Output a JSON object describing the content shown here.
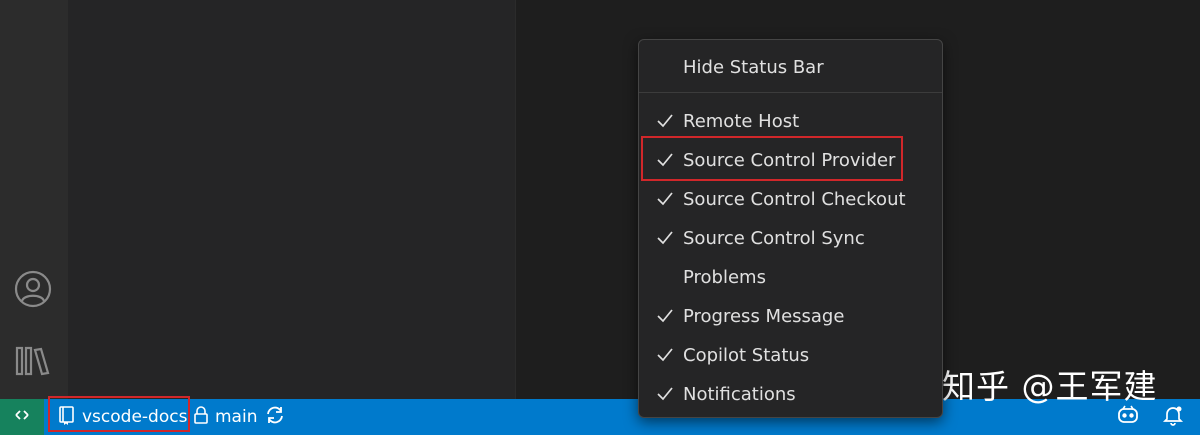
{
  "status_bar": {
    "repo_label": "vscode-docs",
    "branch_label": "main"
  },
  "context_menu": {
    "items": [
      {
        "label": "Hide Status Bar",
        "checked": false
      },
      {
        "label": "Remote Host",
        "checked": true
      },
      {
        "label": "Source Control Provider",
        "checked": true
      },
      {
        "label": "Source Control Checkout",
        "checked": true
      },
      {
        "label": "Source Control Sync",
        "checked": true
      },
      {
        "label": "Problems",
        "checked": false
      },
      {
        "label": "Progress Message",
        "checked": true
      },
      {
        "label": "Copilot Status",
        "checked": true
      },
      {
        "label": "Notifications",
        "checked": true
      }
    ]
  },
  "watermark": "知乎 @王军建",
  "icons": {
    "activity_bar": [
      "accounts-icon",
      "library-icon"
    ],
    "status_bar": [
      "remote-icon",
      "repo-icon",
      "lock-icon",
      "sync-icon",
      "copilot-icon",
      "bell-icon"
    ]
  },
  "colors": {
    "status_bar": "#007acc",
    "remote_item": "#16825d",
    "highlight": "#d1272a"
  }
}
